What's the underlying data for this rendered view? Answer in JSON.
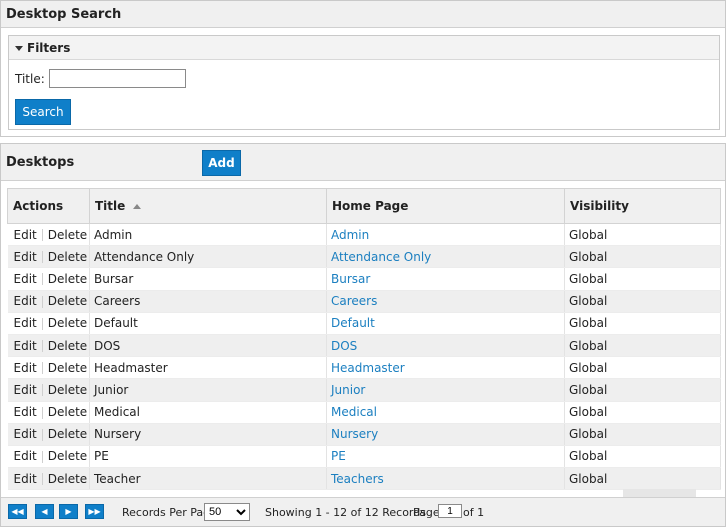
{
  "search_panel": {
    "title": "Desktop Search",
    "filters_label": "Filters",
    "title_label": "Title:",
    "title_value": "",
    "search_button": "Search"
  },
  "desktops_panel": {
    "title": "Desktops",
    "add_button": "Add",
    "columns": [
      "Actions",
      "Title",
      "Home Page",
      "Visibility"
    ],
    "edit_label": "Edit",
    "delete_label": "Delete",
    "rows": [
      {
        "title": "Admin",
        "home_page": "Admin",
        "visibility": "Global"
      },
      {
        "title": "Attendance Only",
        "home_page": "Attendance Only",
        "visibility": "Global"
      },
      {
        "title": "Bursar",
        "home_page": "Bursar",
        "visibility": "Global"
      },
      {
        "title": "Careers",
        "home_page": "Careers",
        "visibility": "Global"
      },
      {
        "title": "Default",
        "home_page": "Default",
        "visibility": "Global"
      },
      {
        "title": "DOS",
        "home_page": "DOS",
        "visibility": "Global"
      },
      {
        "title": "Headmaster",
        "home_page": "Headmaster",
        "visibility": "Global"
      },
      {
        "title": "Junior",
        "home_page": "Junior",
        "visibility": "Global"
      },
      {
        "title": "Medical",
        "home_page": "Medical",
        "visibility": "Global"
      },
      {
        "title": "Nursery",
        "home_page": "Nursery",
        "visibility": "Global"
      },
      {
        "title": "PE",
        "home_page": "PE",
        "visibility": "Global"
      },
      {
        "title": "Teacher",
        "home_page": "Teachers",
        "visibility": "Global"
      }
    ]
  },
  "pager": {
    "records_per_page_label": "Records Per Page",
    "records_per_page_value": "50",
    "showing_text": "Showing 1 - 12 of 12 Records",
    "page_label": "Page",
    "page_value": "1",
    "of_text": "of 1"
  },
  "colors": {
    "accent": "#0f7fc9",
    "link": "#1b7fc0"
  }
}
